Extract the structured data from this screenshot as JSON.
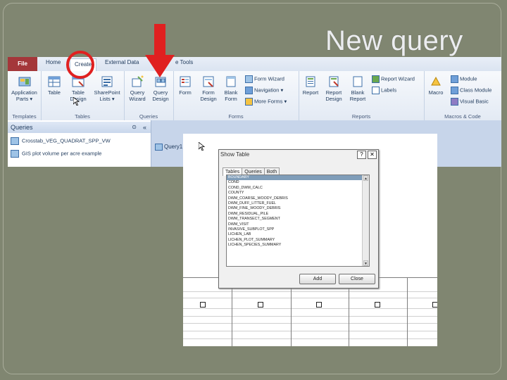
{
  "slide": {
    "title": "New query"
  },
  "ribbon": {
    "tabs": {
      "file": "File",
      "home": "Home",
      "create": "Create",
      "external": "External Data",
      "tools": "e Tools"
    },
    "groups": {
      "templates": "Templates",
      "tables": "Tables",
      "queries": "Queries",
      "forms": "Forms",
      "reports": "Reports",
      "macros": "Macros & Code"
    },
    "buttons": {
      "app_parts_1": "Application",
      "app_parts_2": "Parts ▾",
      "table": "Table",
      "table_design_1": "Table",
      "table_design_2": "Design",
      "sharepoint_1": "SharePoint",
      "sharepoint_2": "Lists ▾",
      "query_wizard_1": "Query",
      "query_wizard_2": "Wizard",
      "query_design_1": "Query",
      "query_design_2": "Design",
      "form": "Form",
      "form_design_1": "Form",
      "form_design_2": "Design",
      "blank_form_1": "Blank",
      "blank_form_2": "Form",
      "form_wizard": "Form Wizard",
      "navigation": "Navigation ▾",
      "more_forms": "More Forms ▾",
      "report": "Report",
      "report_design_1": "Report",
      "report_design_2": "Design",
      "blank_report_1": "Blank",
      "blank_report_2": "Report",
      "report_wizard": "Report Wizard",
      "labels": "Labels",
      "macro": "Macro",
      "module": "Module",
      "class_module": "Class Module",
      "visual_basic": "Visual Basic"
    }
  },
  "nav_pane": {
    "header": "Queries",
    "items": [
      "Crosstab_VEG_QUADRAT_SPP_VW",
      "GIS plot volume per acre example"
    ]
  },
  "design": {
    "tab_label": "Query1"
  },
  "dialog": {
    "title": "Show Table",
    "help": "?",
    "close": "✕",
    "tabs": [
      "Tables",
      "Queries",
      "Both"
    ],
    "tables": [
      "BOUNDARY",
      "COND",
      "COND_DWM_CALC",
      "COUNTY",
      "DWM_COARSE_WOODY_DEBRIS",
      "DWM_DUFF_LITTER_FUEL",
      "DWM_FINE_WOODY_DEBRIS",
      "DWM_RESIDUAL_PILE",
      "DWM_TRANSECT_SEGMENT",
      "DWM_VISIT",
      "INVASIVE_SUBPLOT_SPP",
      "LICHEN_LAB",
      "LICHEN_PLOT_SUMMARY",
      "LICHEN_SPECIES_SUMMARY"
    ],
    "add_button": "Add",
    "close_button": "Close"
  },
  "colors": {
    "annotation": "#e02020",
    "file_tab": "#a4373a",
    "slide_bg": "#808671"
  }
}
